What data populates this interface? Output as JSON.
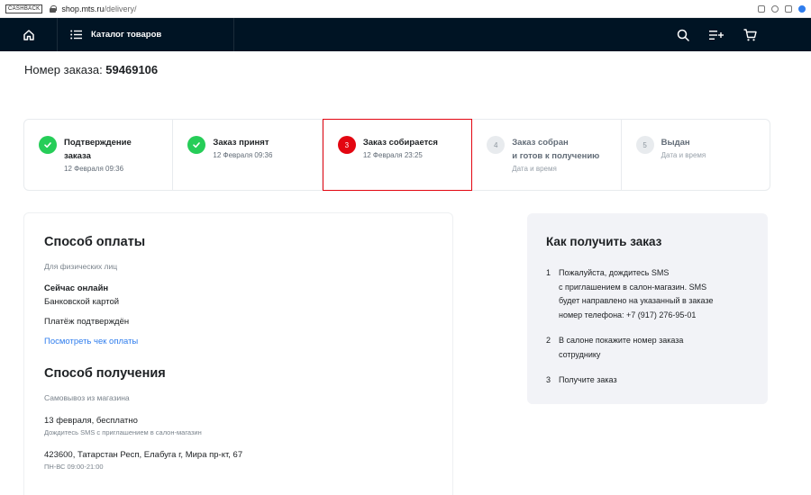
{
  "browser": {
    "cashback": "CASHBACK",
    "url_domain": "shop.mts.ru",
    "url_path": "/delivery/"
  },
  "header": {
    "catalog_label": "Каталог товаров"
  },
  "order": {
    "label": "Номер заказа: ",
    "number": "59469106"
  },
  "steps": [
    {
      "num": "1",
      "title_line1": "Подтверждение",
      "title_line2": "заказа",
      "date": "12 Февраля 09:36",
      "state": "done"
    },
    {
      "num": "2",
      "title_line1": "Заказ принят",
      "title_line2": "",
      "date": "12 Февраля 09:36",
      "state": "done"
    },
    {
      "num": "3",
      "title_line1": "Заказ собирается",
      "title_line2": "",
      "date": "12 Февраля 23:25",
      "state": "current"
    },
    {
      "num": "4",
      "title_line1": "Заказ собран",
      "title_line2": "и готов к получению",
      "date": "Дата и время",
      "state": "pending"
    },
    {
      "num": "5",
      "title_line1": "Выдан",
      "title_line2": "",
      "date": "Дата и время",
      "state": "pending"
    }
  ],
  "payment": {
    "title": "Способ оплаты",
    "subtitle": "Для физических лиц",
    "method_title": "Сейчас онлайн",
    "method_detail": "Банковской картой",
    "status": "Платёж подтверждён",
    "receipt_link": "Посмотреть чек оплаты"
  },
  "delivery": {
    "title": "Способ получения",
    "subtitle": "Самовывоз из магазина",
    "date": "13 февраля, бесплатно",
    "date_note": "Дождитесь SMS с приглашением в салон-магазин",
    "address": "423600, Татарстан Респ, Елабуга г, Мира пр-кт, 67",
    "hours": "ПН-ВС 09:00-21:00"
  },
  "how": {
    "title": "Как получить заказ",
    "items": [
      {
        "num": "1",
        "line1": "Пожалуйста, дождитесь SMS",
        "line2": "с приглашением в салон-магазин. SMS",
        "line3": "будет направлено на указанный в заказе",
        "line4": "номер телефона: +7 (917) 276-95-01"
      },
      {
        "num": "2",
        "line1": "В салоне покажите номер заказа",
        "line2": "сотруднику",
        "line3": "",
        "line4": ""
      },
      {
        "num": "3",
        "line1": "Получите заказ",
        "line2": "",
        "line3": "",
        "line4": ""
      }
    ]
  },
  "colors": {
    "header_bg": "#001424",
    "accent_red": "#e30611",
    "done_green": "#26cd58",
    "link_blue": "#2f7ded",
    "card_gray": "#f2f3f7"
  }
}
